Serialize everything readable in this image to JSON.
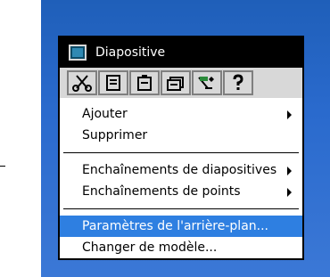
{
  "menu": {
    "title": "Diapositive",
    "toolbar": [
      {
        "icon": "cut-icon"
      },
      {
        "icon": "slide-new-icon"
      },
      {
        "icon": "slide-paste-icon"
      },
      {
        "icon": "slides-stack-icon"
      },
      {
        "icon": "transition-wizard-icon"
      },
      {
        "icon": "help-icon"
      }
    ],
    "items": {
      "ajouter": "Ajouter",
      "supprimer": "Supprimer",
      "enchainements_diapositives": "Enchaînements de diapositives",
      "enchainements_points": "Enchaînements de points",
      "parametres_arriere_plan": "Paramètres de l'arrière-plan...",
      "changer_modele": "Changer de modèle..."
    },
    "selected_item": "Paramètres de l'arrière-plan...",
    "colors": {
      "desktop": "#2a6acd",
      "titlebar": "#000000",
      "highlight": "#2e7fe1",
      "toolbar": "#d8d8d8"
    }
  }
}
